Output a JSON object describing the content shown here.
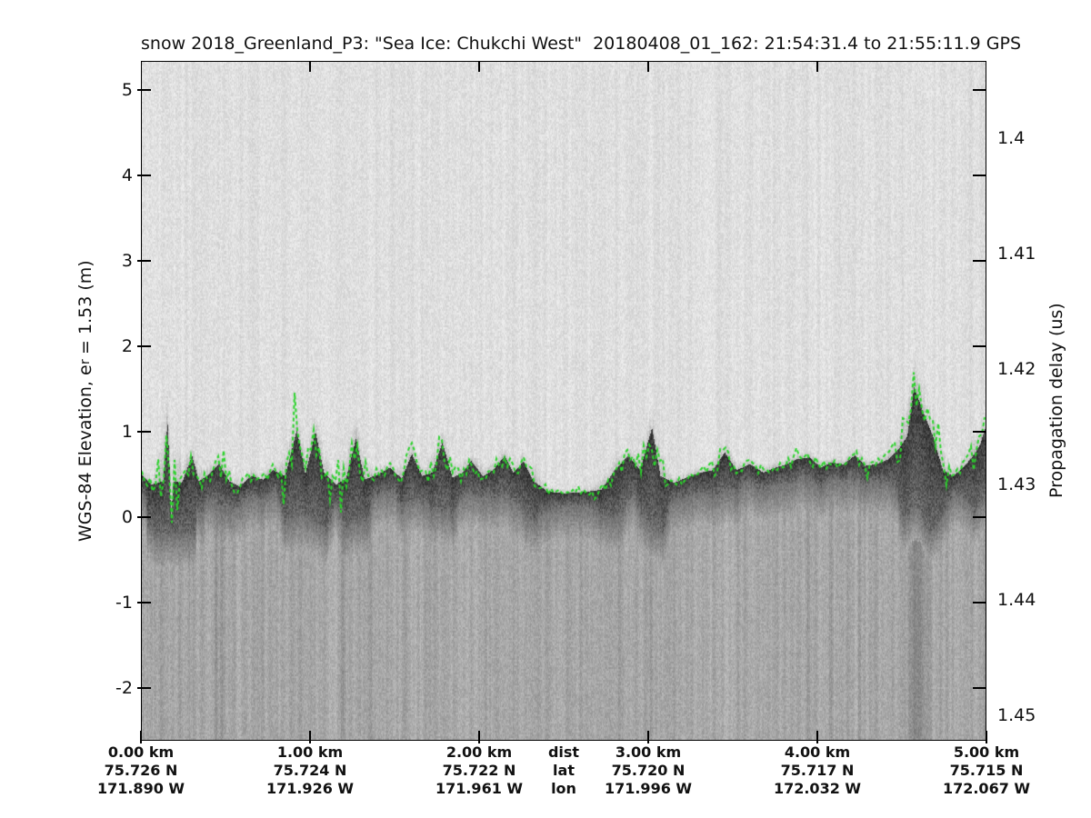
{
  "chart_data": {
    "type": "heatmap",
    "title": "snow 2018_Greenland_P3: \"Sea Ice: Chukchi West\"  20180408_01_162: 21:54:31.4 to 21:55:11.9 GPS",
    "y_left": {
      "label_prefix": "WGS-84 Elevation, e",
      "label_sub": "r",
      "label_suffix": " = 1.53 (m)",
      "ticks": [
        5,
        4,
        3,
        2,
        1,
        0,
        -1,
        -2
      ],
      "ylim": [
        -2.62,
        5.34
      ]
    },
    "y_right": {
      "label": "Propagation delay (us)",
      "ticks": [
        "1.4",
        "1.41",
        "1.42",
        "1.43",
        "1.44",
        "1.45"
      ]
    },
    "x_axis": {
      "header": {
        "dist": "dist",
        "lat": "lat",
        "lon": "lon"
      },
      "tick_km": [
        0,
        1,
        2,
        3,
        4,
        5
      ],
      "columns": [
        {
          "km": 0,
          "dist": "0.00 km",
          "lat": "75.726 N",
          "lon": "171.890 W"
        },
        {
          "km": 1,
          "dist": "1.00 km",
          "lat": "75.724 N",
          "lon": "171.926 W"
        },
        {
          "km": 2,
          "dist": "2.00 km",
          "lat": "75.722 N",
          "lon": "171.961 W"
        },
        {
          "km": 3,
          "dist": "3.00 km",
          "lat": "75.720 N",
          "lon": "171.996 W"
        },
        {
          "km": 4,
          "dist": "4.00 km",
          "lat": "75.717 N",
          "lon": "172.032 W"
        },
        {
          "km": 5,
          "dist": "5.00 km",
          "lat": "75.715 N",
          "lon": "172.067 W"
        }
      ]
    },
    "echogram_colors": {
      "upper_background": "#dfdfdf",
      "lower_background": "#a8a8a8",
      "surface_band": "#3a3a3a",
      "axis": "#000000"
    },
    "surface_line": {
      "name": "tracked snow/ice surface",
      "color": "#2bd32b",
      "style": "dashed",
      "points_km_m": [
        [
          0.0,
          0.5
        ],
        [
          0.06,
          0.38
        ],
        [
          0.13,
          0.42
        ],
        [
          0.155,
          1.12
        ],
        [
          0.168,
          0.55
        ],
        [
          0.175,
          -0.05
        ],
        [
          0.19,
          0.42
        ],
        [
          0.24,
          0.4
        ],
        [
          0.3,
          0.72
        ],
        [
          0.34,
          0.42
        ],
        [
          0.4,
          0.5
        ],
        [
          0.46,
          0.62
        ],
        [
          0.52,
          0.42
        ],
        [
          0.58,
          0.36
        ],
        [
          0.65,
          0.48
        ],
        [
          0.72,
          0.44
        ],
        [
          0.78,
          0.55
        ],
        [
          0.85,
          0.48
        ],
        [
          0.92,
          1.02
        ],
        [
          0.97,
          0.5
        ],
        [
          1.03,
          1.0
        ],
        [
          1.08,
          0.52
        ],
        [
          1.15,
          0.38
        ],
        [
          1.21,
          0.45
        ],
        [
          1.27,
          0.92
        ],
        [
          1.32,
          0.44
        ],
        [
          1.4,
          0.5
        ],
        [
          1.47,
          0.58
        ],
        [
          1.54,
          0.45
        ],
        [
          1.6,
          0.74
        ],
        [
          1.66,
          0.48
        ],
        [
          1.72,
          0.52
        ],
        [
          1.78,
          0.88
        ],
        [
          1.84,
          0.46
        ],
        [
          1.9,
          0.52
        ],
        [
          1.95,
          0.66
        ],
        [
          2.02,
          0.48
        ],
        [
          2.08,
          0.55
        ],
        [
          2.15,
          0.72
        ],
        [
          2.2,
          0.52
        ],
        [
          2.26,
          0.65
        ],
        [
          2.32,
          0.42
        ],
        [
          2.4,
          0.3
        ],
        [
          2.5,
          0.28
        ],
        [
          2.6,
          0.29
        ],
        [
          2.72,
          0.32
        ],
        [
          2.8,
          0.55
        ],
        [
          2.88,
          0.72
        ],
        [
          2.95,
          0.55
        ],
        [
          3.02,
          1.05
        ],
        [
          3.07,
          0.48
        ],
        [
          3.15,
          0.4
        ],
        [
          3.22,
          0.46
        ],
        [
          3.3,
          0.52
        ],
        [
          3.38,
          0.55
        ],
        [
          3.45,
          0.76
        ],
        [
          3.52,
          0.55
        ],
        [
          3.6,
          0.62
        ],
        [
          3.68,
          0.52
        ],
        [
          3.75,
          0.58
        ],
        [
          3.82,
          0.62
        ],
        [
          3.88,
          0.68
        ],
        [
          3.95,
          0.7
        ],
        [
          4.02,
          0.58
        ],
        [
          4.08,
          0.64
        ],
        [
          4.15,
          0.62
        ],
        [
          4.22,
          0.72
        ],
        [
          4.28,
          0.6
        ],
        [
          4.35,
          0.62
        ],
        [
          4.42,
          0.68
        ],
        [
          4.48,
          0.8
        ],
        [
          4.53,
          0.95
        ],
        [
          4.57,
          1.52
        ],
        [
          4.62,
          1.25
        ],
        [
          4.68,
          0.95
        ],
        [
          4.74,
          0.55
        ],
        [
          4.8,
          0.48
        ],
        [
          4.86,
          0.58
        ],
        [
          4.92,
          0.72
        ],
        [
          4.96,
          0.85
        ],
        [
          5.0,
          1.1
        ]
      ]
    }
  }
}
